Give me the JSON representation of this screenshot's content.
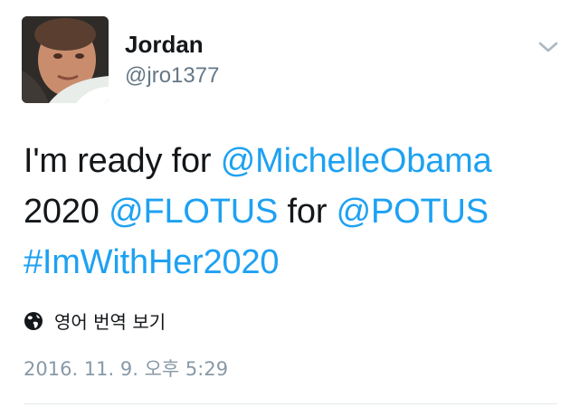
{
  "user": {
    "display_name": "Jordan",
    "handle": "@jro1377"
  },
  "tweet": {
    "segments": [
      {
        "text": "I'm ready for ",
        "type": "text"
      },
      {
        "text": "@MichelleObama",
        "type": "mention"
      },
      {
        "text": " 2020 ",
        "type": "text"
      },
      {
        "text": "@FLOTUS",
        "type": "mention"
      },
      {
        "text": " for ",
        "type": "text"
      },
      {
        "text": "@POTUS",
        "type": "mention"
      },
      {
        "text": " ",
        "type": "text"
      },
      {
        "text": "#ImWithHer2020",
        "type": "hashtag"
      }
    ]
  },
  "translate": {
    "label": "영어 번역 보기",
    "icon": "globe-icon"
  },
  "timestamp": "2016. 11. 9. 오후 5:29",
  "menu": {
    "icon": "chevron-down-icon"
  },
  "colors": {
    "link": "#1da1f2",
    "text": "#14171a",
    "secondary": "#657786",
    "timestamp": "#8899a6",
    "divider": "#e1e8ed"
  }
}
